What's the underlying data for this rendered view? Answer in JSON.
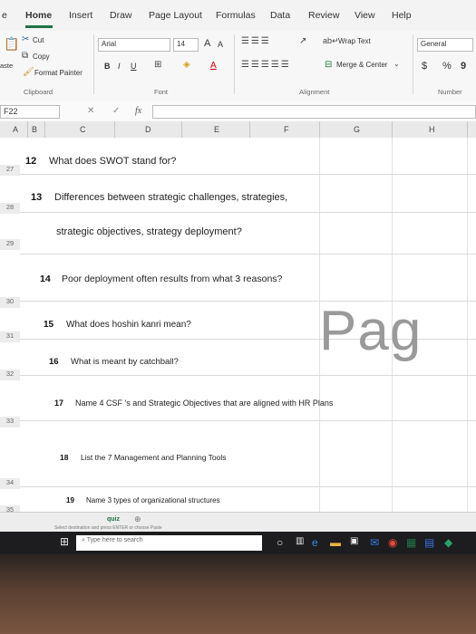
{
  "tabs": [
    "e",
    "Home",
    "Insert",
    "Draw",
    "Page Layout",
    "Formulas",
    "Data",
    "Review",
    "View",
    "Help"
  ],
  "clipboard": {
    "cut": "Cut",
    "copy": "Copy",
    "paste": "aste",
    "format_painter": "Format Painter",
    "label": "Clipboard"
  },
  "font": {
    "name": "Arial",
    "size": "14",
    "bold": "B",
    "italic": "I",
    "underline": "U",
    "grow": "A",
    "shrink": "A",
    "color": "A",
    "label": "Font"
  },
  "alignment": {
    "wrap_text": "Wrap Text",
    "merge_center": "Merge & Center",
    "label": "Alignment"
  },
  "number": {
    "format": "General",
    "currency": "$",
    "percent": "%",
    "comma": "9",
    "label": "Number"
  },
  "formula_bar": {
    "name_box": "F22",
    "fx": "fx",
    "cancel": "✕",
    "enter": "✓"
  },
  "columns": [
    "A",
    "B",
    "C",
    "D",
    "E",
    "F",
    "G",
    "H"
  ],
  "rows": [
    {
      "header": "27",
      "num": "12",
      "text": "What does SWOT stand for?"
    },
    {
      "header": "28",
      "num": "13",
      "text": "Differences between strategic challenges, strategies,"
    },
    {
      "header": "29",
      "num": "",
      "text": "strategic objectives, strategy deployment?"
    },
    {
      "header": "30",
      "num": "14",
      "text": "Poor deployment often results from what 3 reasons?"
    },
    {
      "header": "31",
      "num": "15",
      "text": "What does hoshin kanri mean?"
    },
    {
      "header": "32",
      "num": "16",
      "text": "What is meant by catchball?"
    },
    {
      "header": "33",
      "num": "17",
      "text": "Name 4 CSF 's and Strategic Objectives that are aligned with HR Plans"
    },
    {
      "header": "34",
      "num": "18",
      "text": "List the 7 Management and Planning Tools"
    },
    {
      "header": "35",
      "num": "19",
      "text": "Name 3 types of organizational structures"
    }
  ],
  "watermark": "Pag",
  "sheet": {
    "tab": "quiz",
    "hint": "Select destination and press ENTER or choose Paste"
  },
  "taskbar": {
    "search_placeholder": "Type here to search"
  },
  "colors": {
    "accent": "#217346",
    "taskbar": "#1d1d1f"
  }
}
